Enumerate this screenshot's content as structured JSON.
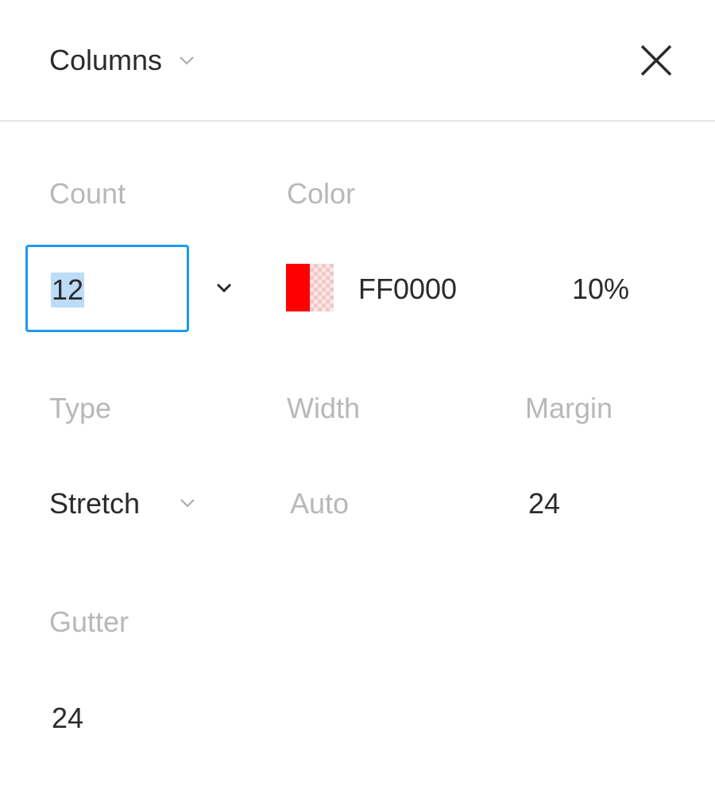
{
  "header": {
    "title": "Columns"
  },
  "labels": {
    "count": "Count",
    "color": "Color",
    "type": "Type",
    "width": "Width",
    "margin": "Margin",
    "gutter": "Gutter"
  },
  "fields": {
    "count": "12",
    "color_hex": "FF0000",
    "opacity": "10%",
    "type": "Stretch",
    "width": "Auto",
    "margin": "24",
    "gutter": "24"
  },
  "colors": {
    "swatch": "#ff0000",
    "focus_border": "#1a9bf0",
    "selection": "#bcdcf8",
    "label_gray": "#b8b8b8",
    "text": "#2b2b2b"
  },
  "icons": {
    "close": "close-icon",
    "dropdown": "chevron-down-icon"
  }
}
